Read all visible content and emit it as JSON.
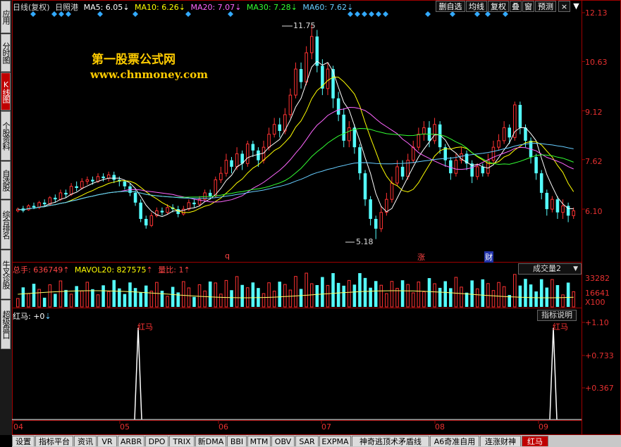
{
  "sidebar": {
    "tabs": [
      {
        "label": "应用",
        "active": false
      },
      {
        "label": "分时图",
        "active": false
      },
      {
        "label": "K线图",
        "active": true
      },
      {
        "label": "个股资料",
        "active": false
      },
      {
        "label": "自选股",
        "active": false
      },
      {
        "label": "综合排名",
        "active": false
      },
      {
        "label": "牛叉诊股",
        "active": false
      },
      {
        "label": "超级盘口",
        "active": false
      }
    ]
  },
  "header": {
    "period": "日线(复权)",
    "stock": "日照港",
    "ma5": {
      "label": "MA5: 6.05",
      "color": "#ffffff"
    },
    "ma10": {
      "label": "MA10: 6.26",
      "color": "#ffff00"
    },
    "ma20": {
      "label": "MA20: 7.07",
      "color": "#ff66ff"
    },
    "ma30": {
      "label": "MA30: 7.28",
      "color": "#33ff33"
    },
    "ma60": {
      "label": "MA60: 7.62",
      "color": "#66ccff"
    }
  },
  "toolbar": {
    "buttons": [
      "删自选",
      "均线",
      "复权",
      "叠",
      "窗",
      "预测"
    ],
    "close": "×",
    "menu": "▼"
  },
  "watermark": {
    "line1": "第一股票公式网",
    "line2": "www.chnmoney.com"
  },
  "price_axis": [
    "12.13",
    "10.63",
    "9.12",
    "7.62",
    "6.10"
  ],
  "annotations": {
    "high": "11.75",
    "low": "5.18",
    "events": [
      "q",
      "涨",
      "财"
    ]
  },
  "volume": {
    "total": "总手: 636749",
    "mavol": "MAVOL20: 827575",
    "ratio": "量比: 1",
    "selector": "成交量2",
    "axis": [
      "33282",
      "16641",
      "X100"
    ]
  },
  "indicator": {
    "name": "红马: +0",
    "help_button": "指标说明",
    "signal_label": "红马",
    "axis": [
      "+1.10",
      "+0.733",
      "+0.367"
    ]
  },
  "time_axis": [
    "04",
    "05",
    "06",
    "07",
    "08",
    "09"
  ],
  "bottom_tabs": [
    "设置",
    "指标平台",
    "资讯",
    "VR",
    "ARBR",
    "DPO",
    "TRIX",
    "新DMA",
    "BBI",
    "MTM",
    "OBV",
    "SAR",
    "EXPMA",
    "神奇逃顶术矛盾线",
    "A6奇准自用",
    "连涨财神",
    "红马"
  ],
  "chart_data": {
    "type": "candlestick",
    "price_range": [
      5.0,
      12.13
    ],
    "ma_values": {
      "MA5": 6.05,
      "MA10": 6.26,
      "MA20": 7.07,
      "MA30": 7.28,
      "MA60": 7.62
    },
    "high_marker": 11.75,
    "low_marker": 5.18,
    "candles": [
      [
        6.05,
        6.1,
        6.0,
        6.15
      ],
      [
        6.12,
        6.05,
        6.0,
        6.2
      ],
      [
        6.08,
        6.2,
        6.05,
        6.25
      ],
      [
        6.2,
        6.15,
        6.1,
        6.3
      ],
      [
        6.15,
        6.3,
        6.1,
        6.35
      ],
      [
        6.3,
        6.25,
        6.2,
        6.4
      ],
      [
        6.25,
        6.45,
        6.2,
        6.5
      ],
      [
        6.45,
        6.4,
        6.3,
        6.55
      ],
      [
        6.4,
        6.6,
        6.35,
        6.7
      ],
      [
        6.6,
        6.55,
        6.45,
        6.7
      ],
      [
        6.55,
        6.8,
        6.5,
        6.9
      ],
      [
        6.8,
        6.75,
        6.65,
        6.95
      ],
      [
        6.75,
        6.95,
        6.7,
        7.05
      ],
      [
        6.95,
        7.0,
        6.85,
        7.1
      ],
      [
        7.0,
        6.95,
        6.85,
        7.1
      ],
      [
        6.95,
        7.1,
        6.9,
        7.2
      ],
      [
        7.1,
        7.05,
        6.95,
        7.2
      ],
      [
        7.05,
        7.15,
        6.95,
        7.25
      ],
      [
        7.15,
        7.0,
        6.9,
        7.25
      ],
      [
        7.0,
        6.95,
        6.8,
        7.1
      ],
      [
        6.95,
        6.8,
        6.7,
        7.0
      ],
      [
        6.8,
        6.6,
        6.5,
        6.9
      ],
      [
        6.6,
        6.3,
        6.2,
        6.7
      ],
      [
        6.3,
        5.8,
        5.7,
        6.4
      ],
      [
        5.8,
        5.6,
        5.5,
        5.9
      ],
      [
        5.6,
        5.9,
        5.55,
        6.0
      ],
      [
        5.9,
        6.05,
        5.85,
        6.15
      ],
      [
        6.05,
        6.0,
        5.9,
        6.15
      ],
      [
        6.0,
        6.15,
        5.95,
        6.25
      ],
      [
        6.15,
        6.1,
        6.0,
        6.25
      ],
      [
        6.1,
        5.95,
        5.85,
        6.2
      ],
      [
        5.95,
        6.1,
        5.9,
        6.2
      ],
      [
        6.1,
        6.3,
        6.05,
        6.4
      ],
      [
        6.3,
        6.25,
        6.15,
        6.4
      ],
      [
        6.25,
        6.4,
        6.2,
        6.5
      ],
      [
        6.4,
        6.6,
        6.35,
        6.7
      ],
      [
        6.6,
        6.5,
        6.4,
        6.7
      ],
      [
        6.5,
        7.0,
        6.45,
        7.1
      ],
      [
        7.0,
        7.2,
        6.9,
        7.4
      ],
      [
        7.2,
        7.6,
        7.1,
        7.8
      ],
      [
        7.6,
        7.4,
        7.2,
        7.7
      ],
      [
        7.4,
        7.8,
        7.3,
        8.0
      ],
      [
        7.8,
        7.5,
        7.3,
        7.9
      ],
      [
        7.5,
        8.1,
        7.4,
        8.2
      ],
      [
        8.1,
        7.9,
        7.7,
        8.2
      ],
      [
        7.9,
        7.6,
        7.4,
        8.0
      ],
      [
        7.6,
        8.0,
        7.5,
        8.2
      ],
      [
        8.0,
        8.4,
        7.9,
        8.6
      ],
      [
        8.4,
        8.7,
        8.3,
        8.9
      ],
      [
        8.7,
        8.5,
        8.3,
        8.9
      ],
      [
        8.5,
        9.0,
        8.4,
        9.2
      ],
      [
        9.0,
        9.6,
        8.9,
        9.8
      ],
      [
        9.6,
        10.4,
        9.5,
        10.6
      ],
      [
        10.4,
        10.0,
        9.8,
        10.6
      ],
      [
        10.0,
        10.9,
        9.9,
        11.1
      ],
      [
        10.9,
        11.4,
        10.7,
        11.75
      ],
      [
        11.4,
        10.5,
        10.3,
        11.6
      ],
      [
        10.5,
        9.8,
        9.6,
        10.7
      ],
      [
        9.8,
        10.4,
        9.6,
        10.6
      ],
      [
        10.4,
        9.5,
        9.2,
        10.5
      ],
      [
        9.5,
        9.0,
        8.8,
        9.7
      ],
      [
        9.0,
        8.2,
        8.0,
        9.2
      ],
      [
        8.2,
        8.6,
        8.0,
        8.8
      ],
      [
        8.6,
        8.0,
        7.8,
        8.7
      ],
      [
        8.0,
        7.2,
        7.0,
        8.1
      ],
      [
        7.2,
        6.4,
        6.2,
        7.3
      ],
      [
        6.4,
        5.8,
        5.6,
        6.5
      ],
      [
        5.8,
        5.5,
        5.18,
        5.9
      ],
      [
        5.5,
        6.0,
        5.4,
        6.2
      ],
      [
        6.0,
        6.4,
        5.9,
        6.6
      ],
      [
        6.4,
        6.9,
        6.3,
        7.1
      ],
      [
        6.9,
        7.4,
        6.8,
        7.6
      ],
      [
        7.4,
        7.1,
        7.0,
        7.6
      ],
      [
        7.1,
        7.6,
        7.0,
        7.8
      ],
      [
        7.6,
        8.0,
        7.5,
        8.2
      ],
      [
        8.0,
        8.4,
        7.9,
        8.6
      ],
      [
        8.4,
        8.6,
        8.2,
        8.8
      ],
      [
        8.6,
        8.2,
        8.0,
        8.8
      ],
      [
        8.2,
        8.7,
        8.1,
        8.9
      ],
      [
        8.7,
        8.0,
        7.8,
        8.8
      ],
      [
        8.0,
        7.6,
        7.4,
        8.1
      ],
      [
        7.6,
        7.2,
        7.0,
        7.7
      ],
      [
        7.2,
        7.6,
        7.1,
        7.8
      ],
      [
        7.6,
        7.8,
        7.5,
        8.0
      ],
      [
        7.8,
        7.5,
        7.3,
        7.9
      ],
      [
        7.5,
        7.1,
        6.9,
        7.6
      ],
      [
        7.1,
        7.4,
        7.0,
        7.5
      ],
      [
        7.4,
        7.2,
        7.1,
        7.5
      ],
      [
        7.2,
        7.6,
        7.1,
        7.8
      ],
      [
        7.6,
        8.0,
        7.5,
        8.2
      ],
      [
        8.0,
        8.2,
        7.9,
        8.4
      ],
      [
        8.2,
        8.6,
        8.1,
        8.8
      ],
      [
        8.6,
        8.3,
        8.1,
        8.7
      ],
      [
        8.3,
        9.3,
        8.2,
        9.4
      ],
      [
        9.3,
        8.6,
        8.4,
        9.4
      ],
      [
        8.6,
        8.2,
        8.0,
        8.7
      ],
      [
        8.2,
        7.7,
        7.5,
        8.3
      ],
      [
        7.7,
        7.2,
        7.0,
        7.8
      ],
      [
        7.2,
        6.6,
        6.4,
        7.3
      ],
      [
        6.6,
        6.1,
        5.9,
        6.7
      ],
      [
        6.1,
        6.4,
        6.0,
        6.5
      ],
      [
        6.4,
        6.0,
        5.8,
        6.5
      ],
      [
        6.0,
        6.2,
        5.8,
        6.4
      ],
      [
        6.2,
        5.9,
        5.7,
        6.3
      ],
      [
        5.9,
        6.05,
        5.8,
        6.15
      ]
    ]
  }
}
